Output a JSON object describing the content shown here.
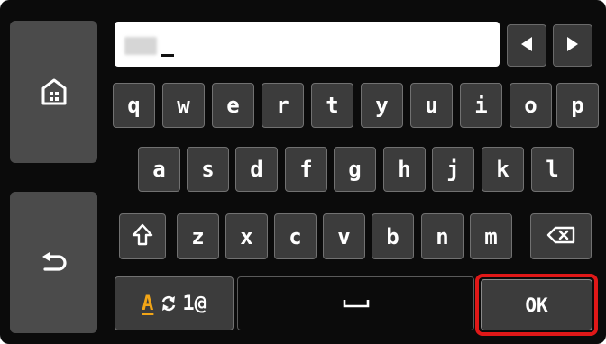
{
  "colors": {
    "screen_bg": "#0b0b0b",
    "side_button_bg": "#4b4b4b",
    "key_bg": "#3c3c3c",
    "key_border": "#717171",
    "highlight_outline": "#e01818",
    "mode_accent": "#f2a516"
  },
  "icons": {
    "home": "home-icon",
    "back": "back-icon",
    "left": "arrow-left-icon",
    "right": "arrow-right-icon",
    "shift": "shift-icon",
    "backspace": "backspace-icon",
    "switch": "switch-icon",
    "space": "space-icon"
  },
  "keyboard": {
    "rows": [
      [
        "q",
        "w",
        "e",
        "r",
        "t",
        "y",
        "u",
        "i",
        "o",
        "p"
      ],
      [
        "a",
        "s",
        "d",
        "f",
        "g",
        "h",
        "j",
        "k",
        "l"
      ],
      [
        "z",
        "x",
        "c",
        "v",
        "b",
        "n",
        "m"
      ]
    ]
  },
  "mode_key": {
    "letter": "A",
    "symbols": "1@"
  },
  "ok_label": "OK"
}
